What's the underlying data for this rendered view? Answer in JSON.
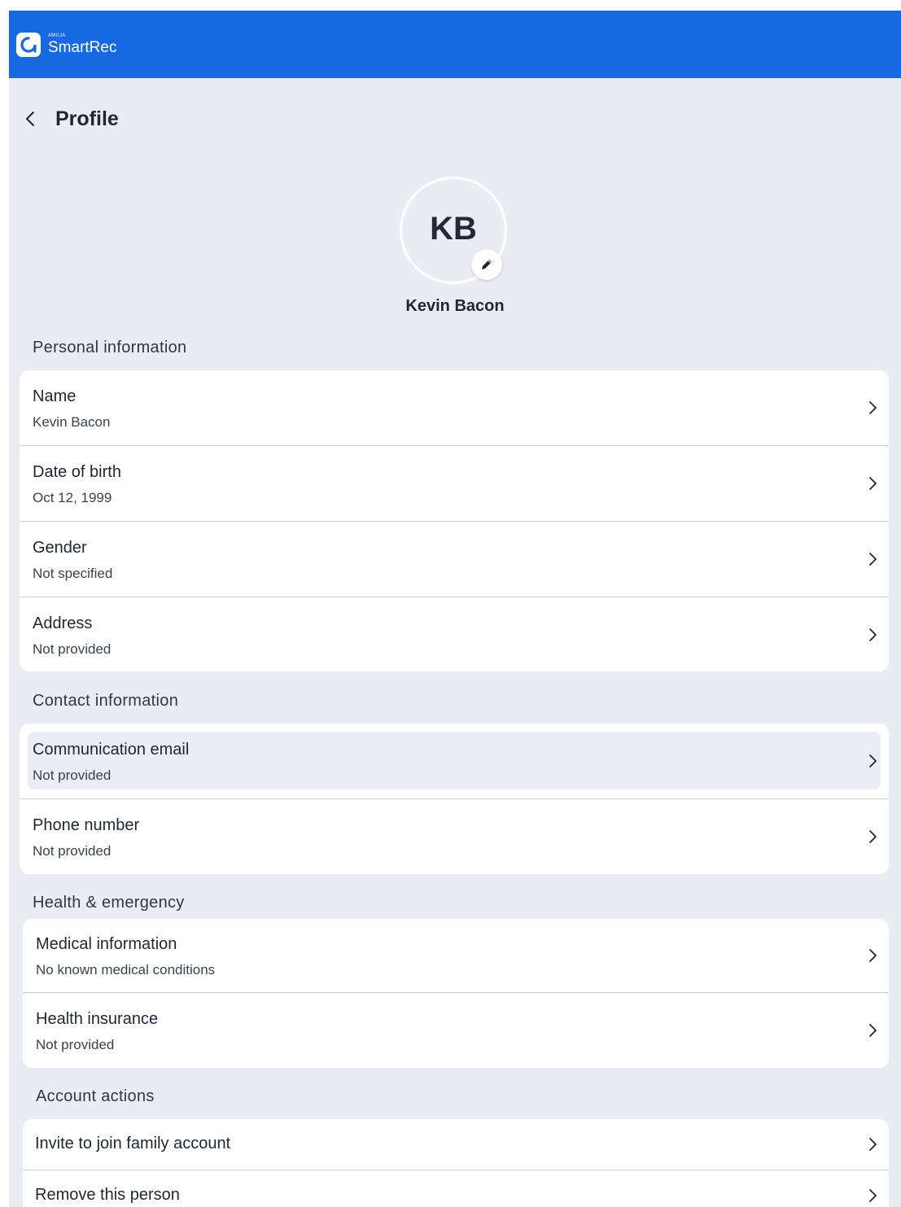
{
  "app": {
    "brand_small": "AMILIA",
    "brand_name": "SmartRec",
    "brand_color": "#1769e0",
    "logo_icon": "amilia-logo-icon"
  },
  "header": {
    "back_icon": "chevron-left-icon",
    "title": "Profile"
  },
  "profile": {
    "initials": "KB",
    "display_name": "Kevin Bacon",
    "edit_icon": "pencil-icon"
  },
  "personal": {
    "title": "Personal information",
    "rows": [
      {
        "label": "Name",
        "value": "Kevin Bacon"
      },
      {
        "label": "Date of birth",
        "value": "Oct 12, 1999"
      },
      {
        "label": "Gender",
        "value": "Not specified"
      },
      {
        "label": "Address",
        "value": "Not provided"
      }
    ]
  },
  "contact": {
    "title": "Contact information",
    "rows": [
      {
        "label": "Communication email",
        "value": "Not provided"
      },
      {
        "label": "Phone number",
        "value": "Not provided"
      }
    ]
  },
  "health": {
    "title": "Health & emergency",
    "rows": [
      {
        "label": "Medical information",
        "value": "No known medical conditions"
      },
      {
        "label": "Health insurance",
        "value": "Not provided"
      }
    ]
  },
  "account": {
    "title": "Account actions",
    "rows": [
      {
        "label": "Invite to join family account"
      },
      {
        "label": "Remove this person"
      }
    ]
  }
}
